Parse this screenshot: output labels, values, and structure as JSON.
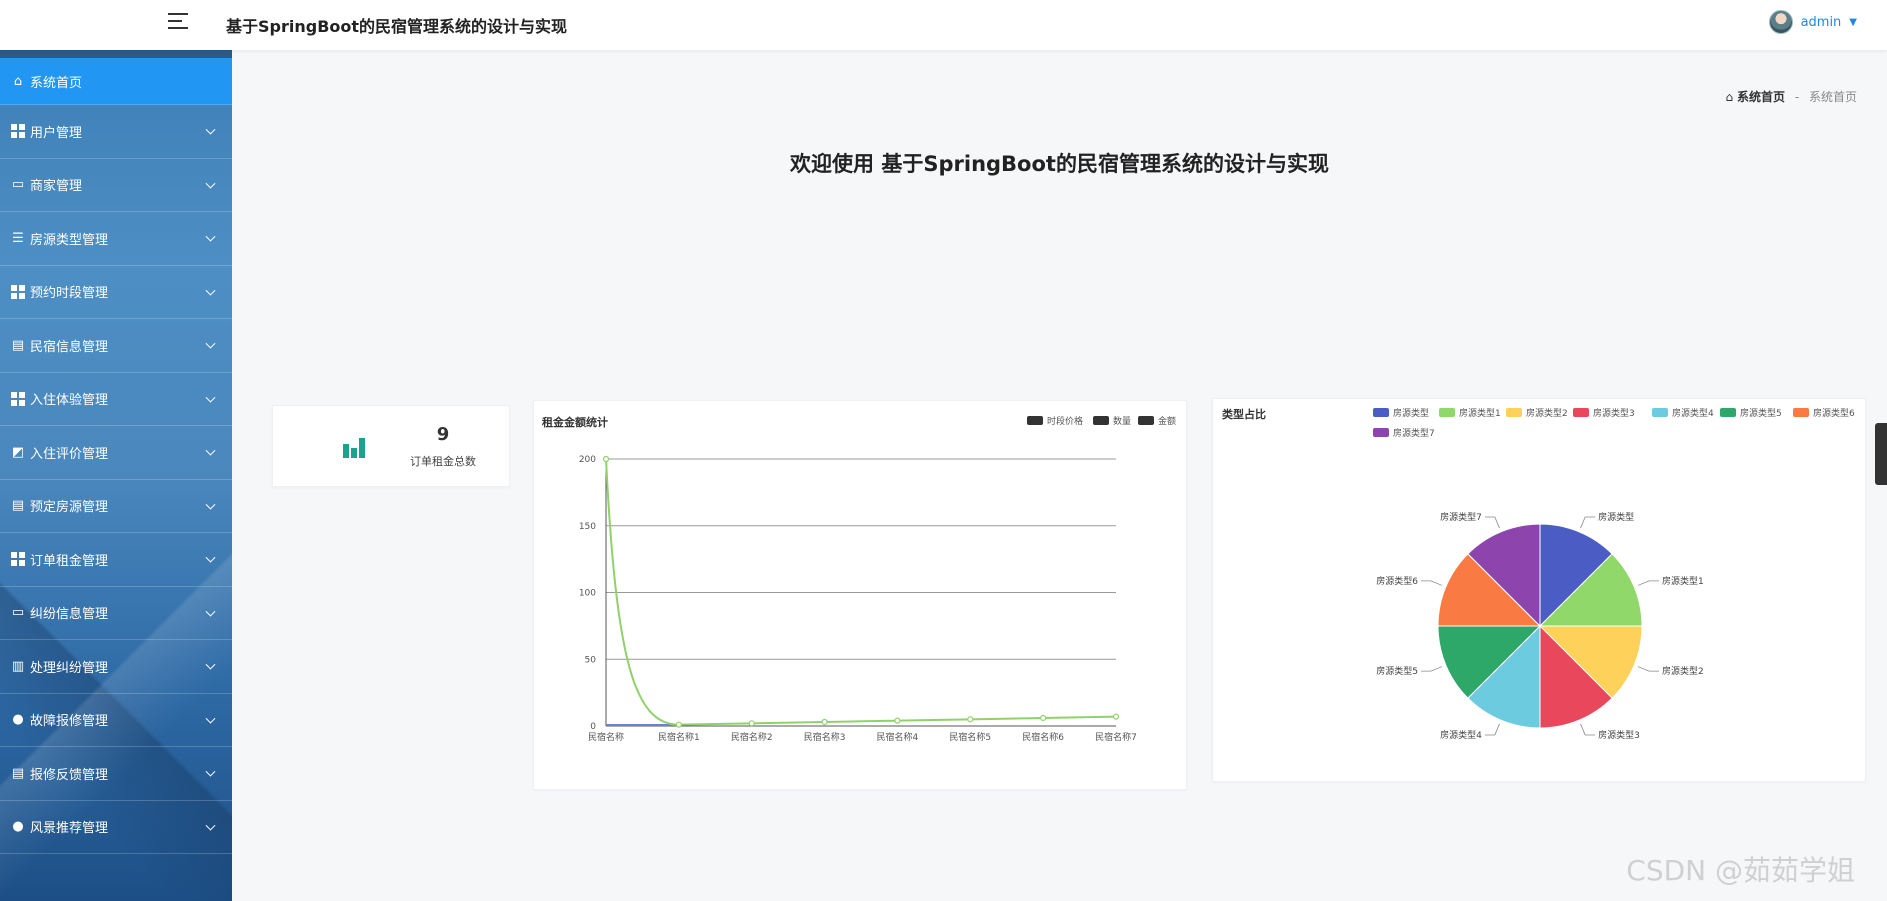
{
  "header": {
    "title": "基于SpringBoot的民宿管理系统的设计与实现",
    "username": "admin"
  },
  "sidebar": {
    "items": [
      {
        "label": "系统首页",
        "icon": "home-icon",
        "active": true
      },
      {
        "label": "用户管理",
        "icon": "grid-icon"
      },
      {
        "label": "商家管理",
        "icon": "message-icon"
      },
      {
        "label": "房源类型管理",
        "icon": "list-icon"
      },
      {
        "label": "预约时段管理",
        "icon": "grid-icon"
      },
      {
        "label": "民宿信息管理",
        "icon": "clipboard-icon"
      },
      {
        "label": "入住体验管理",
        "icon": "grid-icon"
      },
      {
        "label": "入住评价管理",
        "icon": "chart-icon"
      },
      {
        "label": "预定房源管理",
        "icon": "clipboard-icon"
      },
      {
        "label": "订单租金管理",
        "icon": "grid-icon"
      },
      {
        "label": "纠纷信息管理",
        "icon": "message-icon"
      },
      {
        "label": "处理纠纷管理",
        "icon": "columns-icon"
      },
      {
        "label": "故障报修管理",
        "icon": "bulb-icon"
      },
      {
        "label": "报修反馈管理",
        "icon": "clipboard-icon"
      },
      {
        "label": "风景推荐管理",
        "icon": "user-icon"
      }
    ]
  },
  "breadcrumb": {
    "home": "系统首页",
    "separator": "-",
    "current": "系统首页"
  },
  "welcome": "欢迎使用 基于SpringBoot的民宿管理系统的设计与实现",
  "stat": {
    "value": "9",
    "label": "订单租金总数",
    "icon": "bar-chart-icon",
    "color": "#1aa28c"
  },
  "watermark": "CSDN @茹茹学姐",
  "chart_data": [
    {
      "type": "line",
      "title": "租金金额统计",
      "categories": [
        "民宿名称",
        "民宿名称1",
        "民宿名称2",
        "民宿名称3",
        "民宿名称4",
        "民宿名称5",
        "民宿名称6",
        "民宿名称7"
      ],
      "legend": [
        "时段价格",
        "数量",
        "金额"
      ],
      "legend_position": "top-right",
      "ylim": [
        0,
        200
      ],
      "yticks": [
        0,
        50,
        100,
        150,
        200
      ],
      "series": [
        {
          "name": "金额",
          "values": [
            200,
            1,
            2,
            3,
            4,
            5,
            6,
            7
          ],
          "color": "#8fd16a"
        }
      ],
      "grid": true
    },
    {
      "type": "pie",
      "title": "类型占比",
      "legend_position": "top",
      "slices": [
        {
          "label": "房源类型",
          "value": 1,
          "color": "#4b5cc4"
        },
        {
          "label": "房源类型1",
          "value": 1,
          "color": "#91d86b"
        },
        {
          "label": "房源类型2",
          "value": 1,
          "color": "#fdd15a"
        },
        {
          "label": "房源类型3",
          "value": 1,
          "color": "#e9485c"
        },
        {
          "label": "房源类型4",
          "value": 1,
          "color": "#6dcbe0"
        },
        {
          "label": "房源类型5",
          "value": 1,
          "color": "#2ea868"
        },
        {
          "label": "房源类型6",
          "value": 1,
          "color": "#fa7a43"
        },
        {
          "label": "房源类型7",
          "value": 1,
          "color": "#8e44ad"
        }
      ]
    }
  ]
}
